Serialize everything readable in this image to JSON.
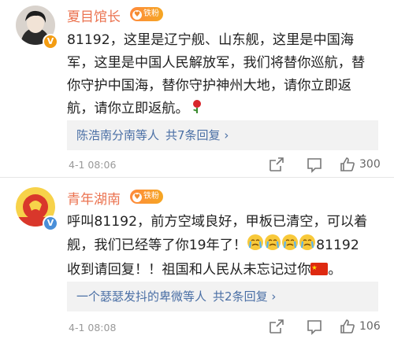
{
  "comments": [
    {
      "username": "夏目馆长",
      "fan_badge": "铁粉",
      "lines": [
        "81192，这里是辽宁舰、山东舰，这里是中国海",
        "军，这里是中国人民解放军，我们将替你巡航，替",
        "你守护中国海，替你守护神州大地，请你立即返",
        "航，请你立即返航。"
      ],
      "trailing_emoji": "rose-emoji",
      "replies": {
        "names": "陈浩南分南等人",
        "count": "共7条回复"
      },
      "time": "4-1 08:06",
      "likes": "300"
    },
    {
      "username": "青年湖南",
      "fan_badge": "铁粉",
      "lines": [
        "呼叫81192，前方空域良好，甲板已清空，可以着",
        "舰，我们已经等了你19年了！",
        "收到请回复！！祖国和人民从未忘记过你"
      ],
      "line2_tail": "81192",
      "line3_tail": "。",
      "emojis": [
        "crying-emoji",
        "crying-emoji",
        "crying-emoji",
        "crying-emoji"
      ],
      "flag": "china-flag-emoji",
      "replies": {
        "names": "一个瑟瑟发抖的卑微",
        "suffix": "等人",
        "count": "共2条回复"
      },
      "time": "4-1 08:08",
      "likes": "106"
    }
  ],
  "colors": {
    "username": "#eb7350",
    "link": "#4a6fa5",
    "reply_bg": "#f2f2f2",
    "badge": "#f5a623"
  },
  "icons": [
    "share-icon",
    "comment-icon",
    "like-icon"
  ]
}
